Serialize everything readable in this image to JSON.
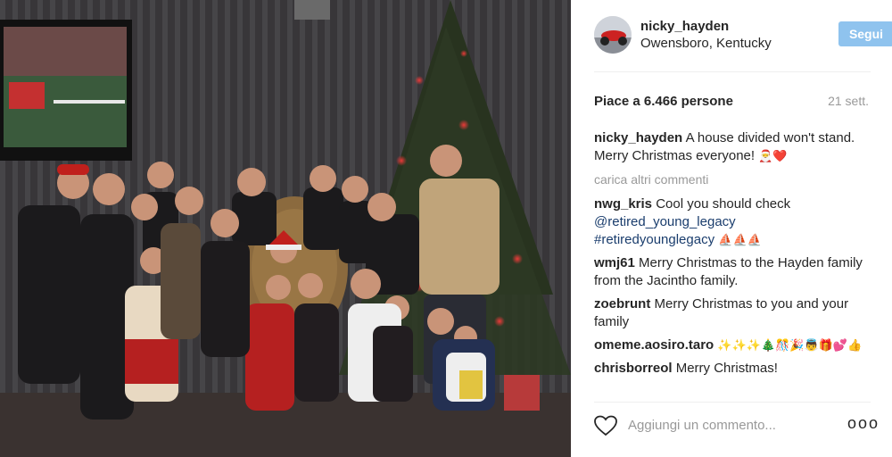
{
  "post": {
    "username": "nicky_hayden",
    "location": "Owensboro, Kentucky",
    "follow_label": "Segui",
    "likes": "Piace a 6.466 persone",
    "date": "21 sett.",
    "load_more": "carica altri commenti",
    "add_comment_placeholder": "Aggiungi un commento...",
    "options_label": "ooo"
  },
  "comments": [
    {
      "user": "nicky_hayden",
      "text": "A house divided won't stand. Merry Christmas everyone!",
      "emoji": "🎅❤️"
    },
    {
      "user": "nwg_kris",
      "text": "Cool you should check",
      "mention": "@retired_young_legacy",
      "hashtag": "#retiredyounglegacy",
      "emoji": "⛵⛵⛵"
    },
    {
      "user": "wmj61",
      "text": "Merry Christmas to the Hayden family from the Jacintho family."
    },
    {
      "user": "zoebrunt",
      "text": "Merry Christmas to you and your family"
    },
    {
      "user": "omeme.aosiro.taro",
      "text": "",
      "emoji": "✨✨✨🎄🎊🎉👼🎁💕👍"
    },
    {
      "user": "chrisborreol",
      "text": "Merry Christmas!"
    }
  ],
  "colors": {
    "follow_button": "#8fc3ee",
    "link": "#1a3d6d",
    "muted": "#999999"
  },
  "icons": [
    "heart-icon",
    "options-icon"
  ]
}
